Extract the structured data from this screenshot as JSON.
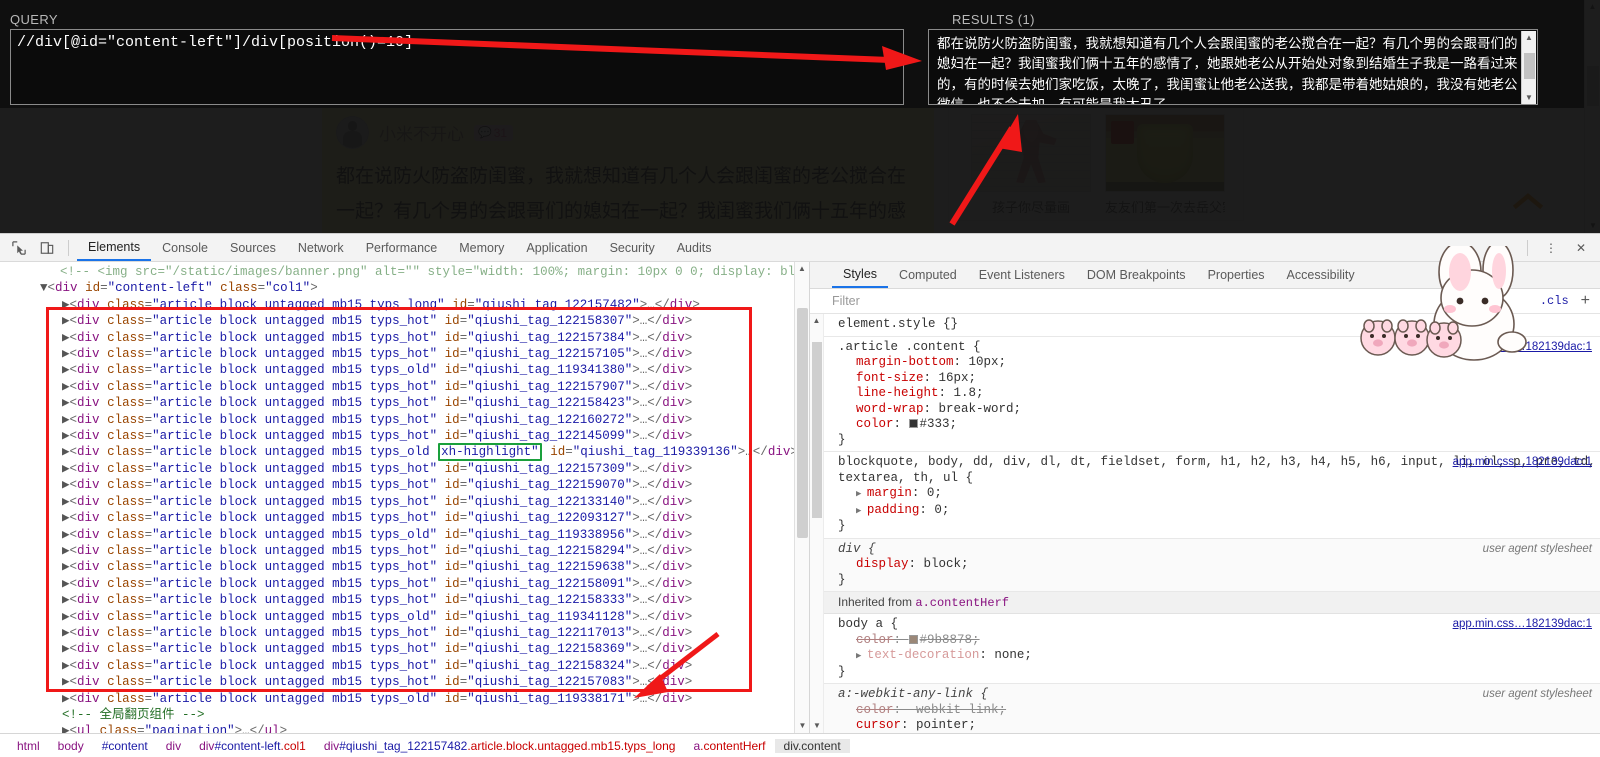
{
  "xpath_helper": {
    "query_label": "QUERY",
    "results_label": "RESULTS (1)",
    "query_value": "//div[@id=\"content-left\"]/div[position()=10]",
    "results_value": "都在说防火防盗防闺蜜，我就想知道有几个人会跟闺蜜的老公搅合在一起？有几个男的会跟哥们的媳妇在一起？我闺蜜我们俩十五年的感情了，她跟她老公从开始处对象到结婚生子我是一路看过来的，有的时候去她们家吃饭，太晚了，我闺蜜让他老公送我，我都是带着她姑娘的，我没有她老公微信，也不会去加，有可能是我太丑了……"
  },
  "page": {
    "post": {
      "username": "小米不开心",
      "comment_count": "31",
      "body": "都在说防火防盗防闺蜜，我就想知道有几个人会跟闺蜜的老公搅合在一起？有几个男的会跟哥们的媳妇在一起？我闺蜜我们俩十五年的感情了，她跟她老公从开始处对象到结婚生子我是一路看过来的，有的时候去她们家吃饭，太晚了，我闺蜜让他老公送"
    },
    "thumb_cards": [
      {
        "caption": "孩子你尽量画"
      },
      {
        "caption": "友友们第一次去岳父家"
      }
    ],
    "scroll_top_label": "回到顶部"
  },
  "devtools": {
    "toolbar_icons": [
      "inspect-element-icon",
      "device-toolbar-icon"
    ],
    "tabs": [
      {
        "label": "Elements",
        "active": true
      },
      {
        "label": "Console",
        "active": false
      },
      {
        "label": "Sources",
        "active": false
      },
      {
        "label": "Network",
        "active": false
      },
      {
        "label": "Performance",
        "active": false
      },
      {
        "label": "Memory",
        "active": false
      },
      {
        "label": "Application",
        "active": false
      },
      {
        "label": "Security",
        "active": false
      },
      {
        "label": "Audits",
        "active": false
      }
    ],
    "more_label": "⋮",
    "close_label": "✕",
    "dom": {
      "top_comment": "<!-- <img src=\"/static/images/banner.png\" alt=\"\" style=\"width: 100%; margin: 10px 0 0; display: block\" /> -->",
      "parent_open": {
        "tag": "div",
        "attrs": "id=\"content-left\" class=\"col1\""
      },
      "rows": [
        {
          "classes": "article block untagged mb15 typs_long",
          "id": "qiushi_tag_122157482",
          "highlight": false
        },
        {
          "classes": "article block untagged mb15 typs_hot",
          "id": "qiushi_tag_122158307",
          "highlight": false
        },
        {
          "classes": "article block untagged mb15 typs_hot",
          "id": "qiushi_tag_122157384",
          "highlight": false
        },
        {
          "classes": "article block untagged mb15 typs_hot",
          "id": "qiushi_tag_122157105",
          "highlight": false
        },
        {
          "classes": "article block untagged mb15 typs_old",
          "id": "qiushi_tag_119341380",
          "highlight": false
        },
        {
          "classes": "article block untagged mb15 typs_hot",
          "id": "qiushi_tag_122157907",
          "highlight": false
        },
        {
          "classes": "article block untagged mb15 typs_hot",
          "id": "qiushi_tag_122158423",
          "highlight": false
        },
        {
          "classes": "article block untagged mb15 typs_hot",
          "id": "qiushi_tag_122160272",
          "highlight": false
        },
        {
          "classes": "article block untagged mb15 typs_hot",
          "id": "qiushi_tag_122145099",
          "highlight": false
        },
        {
          "classes": "article block untagged mb15 typs_old",
          "id": "qiushi_tag_119339136",
          "highlight": true,
          "highlight_class": "xh-highlight"
        },
        {
          "classes": "article block untagged mb15 typs_hot",
          "id": "qiushi_tag_122157309",
          "highlight": false
        },
        {
          "classes": "article block untagged mb15 typs_hot",
          "id": "qiushi_tag_122159070",
          "highlight": false
        },
        {
          "classes": "article block untagged mb15 typs_hot",
          "id": "qiushi_tag_122133140",
          "highlight": false
        },
        {
          "classes": "article block untagged mb15 typs_hot",
          "id": "qiushi_tag_122093127",
          "highlight": false
        },
        {
          "classes": "article block untagged mb15 typs_old",
          "id": "qiushi_tag_119338956",
          "highlight": false
        },
        {
          "classes": "article block untagged mb15 typs_hot",
          "id": "qiushi_tag_122158294",
          "highlight": false
        },
        {
          "classes": "article block untagged mb15 typs_hot",
          "id": "qiushi_tag_122159638",
          "highlight": false
        },
        {
          "classes": "article block untagged mb15 typs_hot",
          "id": "qiushi_tag_122158091",
          "highlight": false
        },
        {
          "classes": "article block untagged mb15 typs_hot",
          "id": "qiushi_tag_122158333",
          "highlight": false
        },
        {
          "classes": "article block untagged mb15 typs_old",
          "id": "qiushi_tag_119341128",
          "highlight": false
        },
        {
          "classes": "article block untagged mb15 typs_hot",
          "id": "qiushi_tag_122117013",
          "highlight": false
        },
        {
          "classes": "article block untagged mb15 typs_hot",
          "id": "qiushi_tag_122158369",
          "highlight": false
        },
        {
          "classes": "article block untagged mb15 typs_hot",
          "id": "qiushi_tag_122158324",
          "highlight": false
        },
        {
          "classes": "article block untagged mb15 typs_hot",
          "id": "qiushi_tag_122157083",
          "highlight": false
        },
        {
          "classes": "article block untagged mb15 typs_old",
          "id": "qiushi_tag_119338171",
          "highlight": false
        }
      ],
      "pagination_comment": "<!-- 全局翻页组件 -->",
      "pagination_line": "<ul class=\"pagination\">…</ul>",
      "closing_div": "</div>"
    },
    "styles": {
      "tabs": [
        {
          "label": "Styles",
          "active": true
        },
        {
          "label": "Computed",
          "active": false
        },
        {
          "label": "Event Listeners",
          "active": false
        },
        {
          "label": "DOM Breakpoints",
          "active": false
        },
        {
          "label": "Properties",
          "active": false
        },
        {
          "label": "Accessibility",
          "active": false
        }
      ],
      "filter_placeholder": "Filter",
      "cls_label": ".cls",
      "plus_label": "+",
      "rules": [
        {
          "selector": "element.style {",
          "source": "",
          "props": []
        },
        {
          "selector": ".article .content {",
          "source": "app.min.css…182139dac:1",
          "props": [
            {
              "name": "margin-bottom",
              "value": "10px;"
            },
            {
              "name": "font-size",
              "value": "16px;"
            },
            {
              "name": "line-height",
              "value": "1.8;"
            },
            {
              "name": "word-wrap",
              "value": "break-word;"
            },
            {
              "name": "color",
              "value": "#333;",
              "swatch": "#333333"
            }
          ]
        },
        {
          "selector": "blockquote, body, dd, div, dl, dt, fieldset, form, h1, h2, h3, h4, h5, h6, input, li, ol, p, pre, td, textarea, th, ul {",
          "source": "app.min.css…182139dac:1",
          "props": [
            {
              "name": "margin",
              "value": "0;",
              "expander": true
            },
            {
              "name": "padding",
              "value": "0;",
              "expander": true
            }
          ]
        },
        {
          "selector": "div {",
          "source": "user agent stylesheet",
          "ua": true,
          "props": [
            {
              "name": "display",
              "value": "block;"
            }
          ]
        }
      ],
      "inherited_label": "Inherited from",
      "inherited_from": "a.contentHerf",
      "inherited_rules": [
        {
          "selector": "body a {",
          "source": "app.min.css…182139dac:1",
          "props": [
            {
              "name": "color",
              "value": "#9b8878;",
              "swatch": "#9b8878",
              "strike": true
            },
            {
              "name": "text-decoration",
              "value": "none;",
              "expander": true,
              "gray": true
            }
          ]
        },
        {
          "selector": "a:-webkit-any-link {",
          "source": "user agent stylesheet",
          "ua": true,
          "props": [
            {
              "name": "color",
              "value": "-webkit-link;",
              "strike": true
            },
            {
              "name": "cursor",
              "value": "pointer;"
            }
          ]
        }
      ]
    },
    "breadcrumb": [
      {
        "text": "html",
        "type": "tag"
      },
      {
        "text": "body",
        "type": "tag"
      },
      {
        "text": "#content",
        "type": "id"
      },
      {
        "text": "div",
        "type": "tag"
      },
      {
        "text": "div#content-left.col1",
        "type": "mixed"
      },
      {
        "text": "div#qiushi_tag_122157482.article.block.untagged.mb15.typs_long",
        "type": "mixed"
      },
      {
        "text": "a.contentHerf",
        "type": "mixed"
      },
      {
        "text": "div.content",
        "type": "selected"
      }
    ]
  },
  "colors": {
    "accent_blue": "#1a73e8",
    "annotation_red": "#f01818",
    "highlight_yellow": "#ffffaa",
    "highlight_green": "#1aa03c",
    "scroll_top_orange": "#f7941e"
  }
}
